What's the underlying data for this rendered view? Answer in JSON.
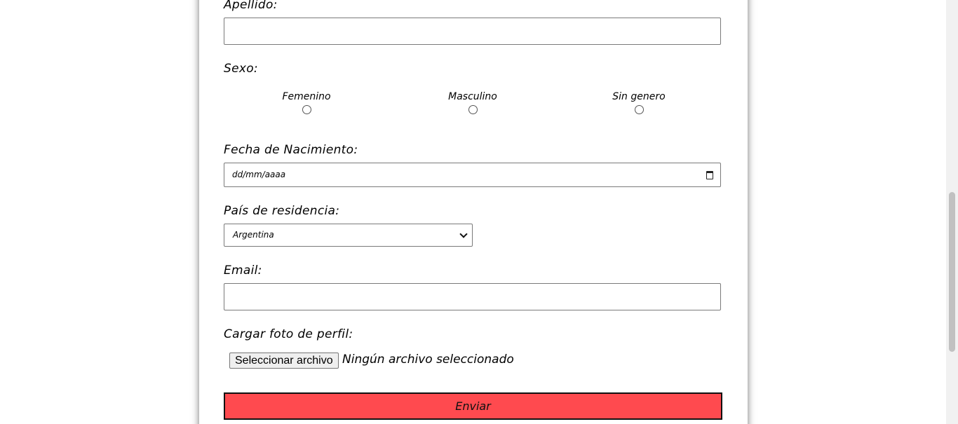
{
  "form": {
    "apellido_label": "Apellido:",
    "apellido_value": "",
    "sexo_label": "Sexo:",
    "sexo_options": [
      "Femenino",
      "Masculino",
      "Sin genero"
    ],
    "fecha_label": "Fecha de Nacimiento:",
    "fecha_placeholder": "dd/mm/aaaa",
    "pais_label": "País de residencia:",
    "pais_selected": "Argentina",
    "email_label": "Email:",
    "email_value": "",
    "foto_label": "Cargar foto de perfil:",
    "file_button_label": "Seleccionar archivo",
    "file_status": "Ningún archivo seleccionado",
    "submit_label": "Enviar"
  },
  "icons": {
    "calendar": "calendar-icon",
    "select_arrow": "chevron-down-icon"
  },
  "colors": {
    "submit_bg": "#ff4a4f",
    "border": "#7a7a7a"
  }
}
